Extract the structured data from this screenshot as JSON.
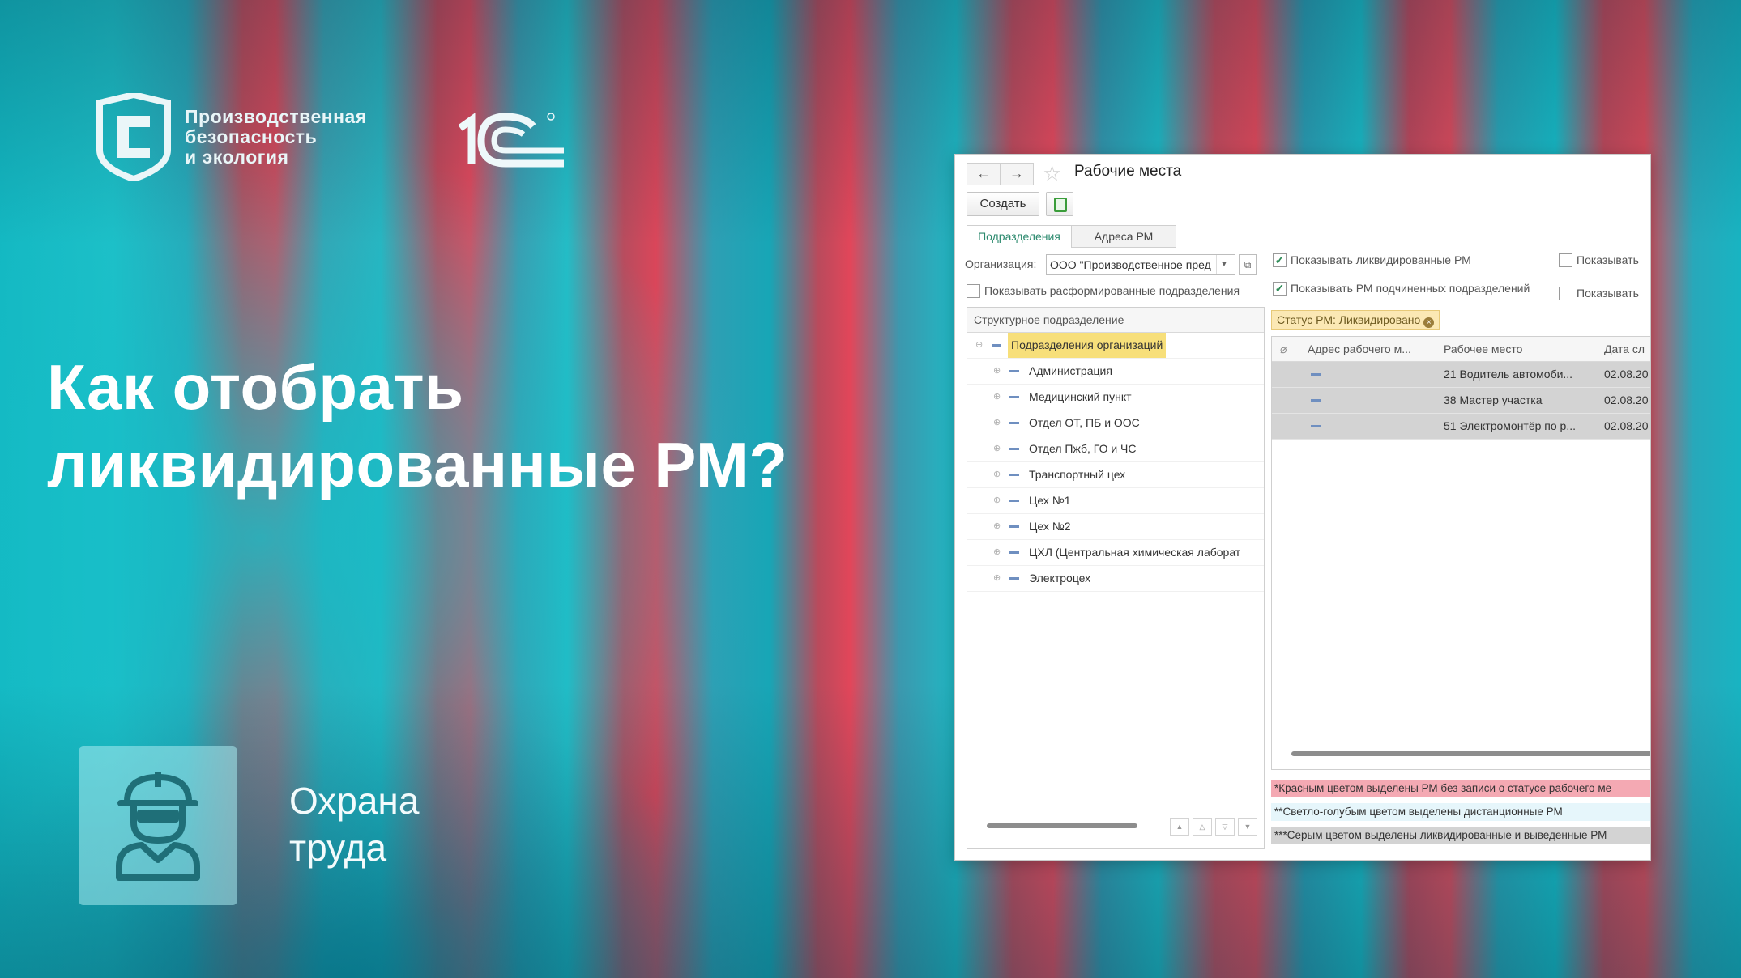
{
  "brand": {
    "name_lines": [
      "Производственная",
      "безопасность",
      "и экология"
    ],
    "partner_logo": "1С"
  },
  "headline": [
    "Как отобрать",
    "ликвидированные РМ?"
  ],
  "badge": {
    "icon": "worker-helmet-icon",
    "text_lines": [
      "Охрана",
      "труда"
    ]
  },
  "window": {
    "title": "Рабочие места",
    "nav": {
      "back": "←",
      "forward": "→"
    },
    "toolbar": {
      "create_label": "Создать",
      "refresh_icon": "refresh-icon"
    },
    "tabs": [
      {
        "label": "Подразделения",
        "active": true
      },
      {
        "label": "Адреса РМ",
        "active": false
      }
    ],
    "org_label": "Организация:",
    "org_value": "ООО \"Производственное пред",
    "filters": {
      "show_disbanded": {
        "label": "Показывать расформированные подразделения",
        "checked": false
      },
      "show_liquidated": {
        "label": "Показывать ликвидированные РМ",
        "checked": true
      },
      "show_subordinate": {
        "label": "Показывать РМ подчиненных подразделений",
        "checked": true
      },
      "show_other_1": {
        "label": "Показывать",
        "checked": false
      },
      "show_other_2": {
        "label": "Показывать",
        "checked": false
      }
    },
    "tree": {
      "header": "Структурное подразделение",
      "root": "Подразделения организаций",
      "items": [
        "Администрация",
        "Медицинский пункт",
        "Отдел ОТ, ПБ и ООС",
        "Отдел Пжб, ГО и ЧС",
        "Транспортный цех",
        "Цех №1",
        "Цех №2",
        "ЦХЛ (Центральная химическая лаборат",
        "Электроцех"
      ]
    },
    "status_filter": {
      "label": "Статус РМ: Ликвидировано",
      "clear": "×"
    },
    "grid": {
      "columns": [
        "Адрес рабочего м...",
        "Рабочее место",
        "Дата сл"
      ],
      "rows": [
        {
          "workplace": "21 Водитель автомоби...",
          "date": "02.08.20"
        },
        {
          "workplace": "38 Мастер участка",
          "date": "02.08.20"
        },
        {
          "workplace": "51 Электромонтёр по р...",
          "date": "02.08.20"
        }
      ]
    },
    "legend": [
      {
        "text": "*Красным цветом выделены РМ без записи о статусе рабочего ме",
        "color": "#f4a9b3"
      },
      {
        "text": "**Светло-голубым цветом выделены дистанционные РМ",
        "color": "#e6f6fb"
      },
      {
        "text": "***Серым цветом выделены ликвидированные и выведенные РМ",
        "color": "#d3d3d3"
      }
    ]
  }
}
